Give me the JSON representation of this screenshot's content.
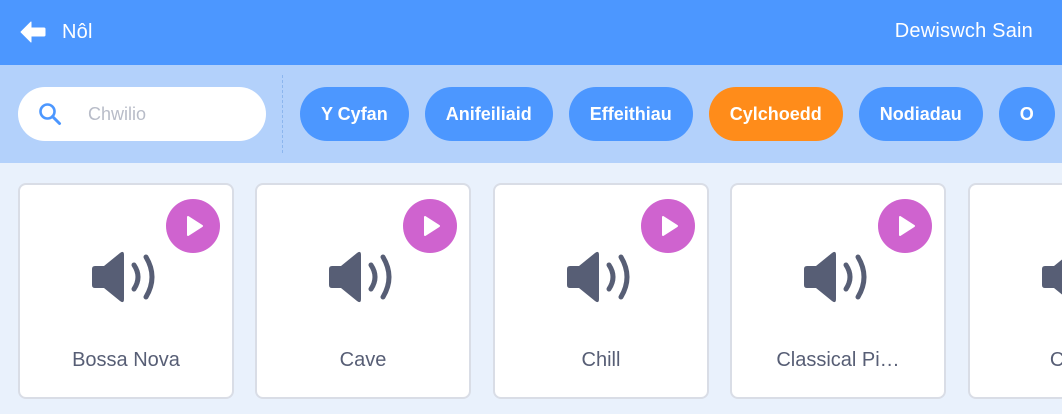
{
  "header": {
    "back_label": "Nôl",
    "title": "Dewiswch Sain",
    "back_icon": "arrow-left-icon"
  },
  "search": {
    "placeholder": "Chwilio",
    "value": "",
    "icon": "search-icon"
  },
  "categories": [
    {
      "label": "Y Cyfan",
      "active": false
    },
    {
      "label": "Anifeiliaid",
      "active": false
    },
    {
      "label": "Effeithiau",
      "active": false
    },
    {
      "label": "Cylchoedd",
      "active": true
    },
    {
      "label": "Nodiadau",
      "active": false
    },
    {
      "label": "O",
      "active": false
    }
  ],
  "sounds": [
    {
      "name": "Bossa Nova"
    },
    {
      "name": "Cave"
    },
    {
      "name": "Chill"
    },
    {
      "name": "Classical Pi…"
    },
    {
      "name": "Cymb"
    }
  ],
  "colors": {
    "header": "#4c97ff",
    "filter_bar": "#b3d1fb",
    "chip": "#4c97ff",
    "chip_active": "#ff8c1a",
    "play_button": "#cf63cf",
    "speaker_icon": "#575e75",
    "background": "#e9f1fc"
  }
}
